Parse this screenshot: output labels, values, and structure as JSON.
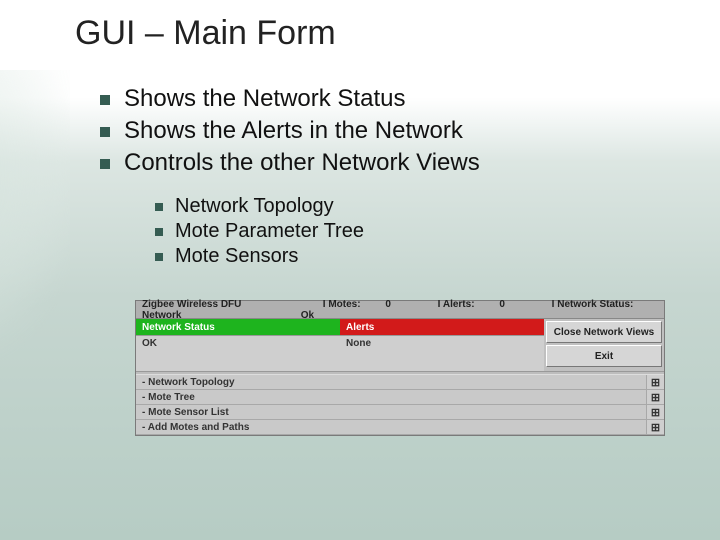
{
  "title": "GUI – Main Form",
  "bullets": [
    "Shows the Network Status",
    "Shows the Alerts in the Network",
    "Controls the other Network Views"
  ],
  "subbullets": [
    "Network Topology",
    "Mote Parameter Tree",
    "Mote Sensors"
  ],
  "shot": {
    "app_title": "Zigbee Wireless DFU Network",
    "stats": {
      "motes_label": "I Motes:",
      "motes_value": "0",
      "alerts_label": "I Alerts:",
      "alerts_value": "0",
      "netstatus_label": "I Network Status:",
      "netstatus_value": "Ok"
    },
    "status": {
      "heading": "Network Status",
      "body": "OK"
    },
    "alerts": {
      "heading": "Alerts",
      "body": "None"
    },
    "buttons": {
      "close": "Close Network Views",
      "exit": "Exit"
    },
    "rows": [
      {
        "label": "- Network Topology"
      },
      {
        "label": "- Mote Tree"
      },
      {
        "label": "- Mote Sensor List"
      },
      {
        "label": "- Add Motes and Paths"
      }
    ],
    "expand_glyph": "⊞"
  }
}
